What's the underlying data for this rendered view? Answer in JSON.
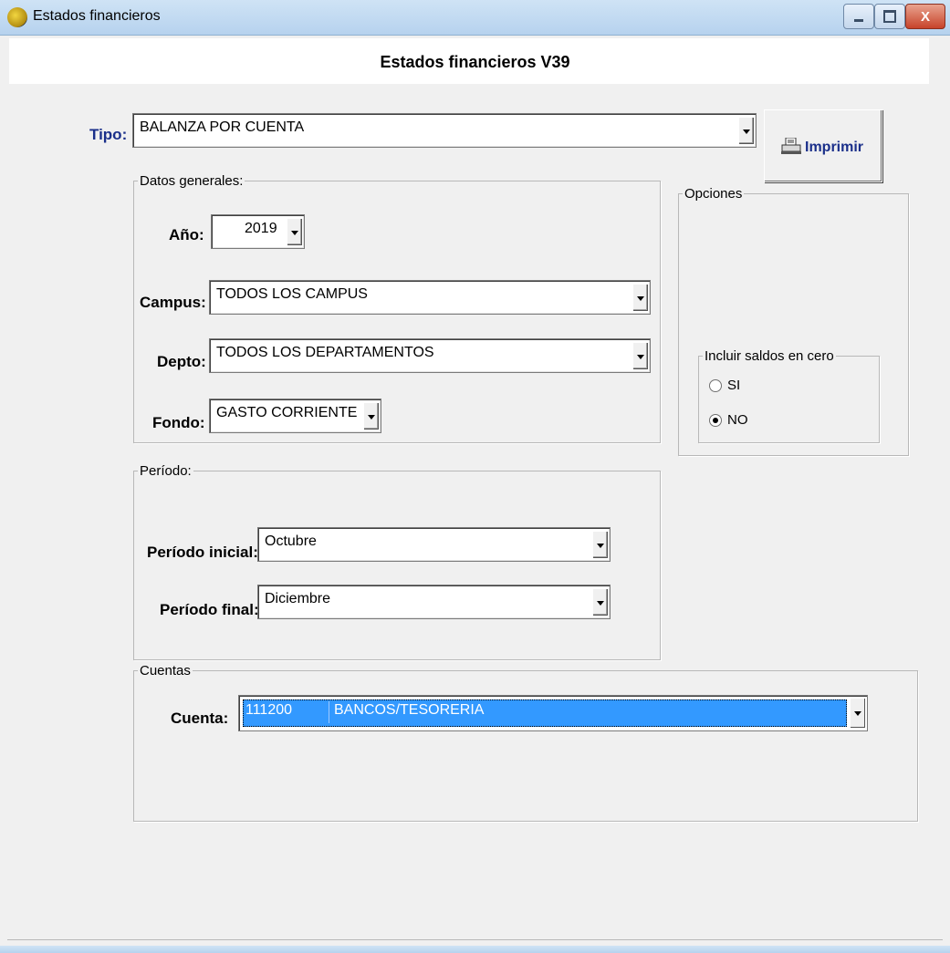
{
  "window": {
    "title": "Estados financieros",
    "buttons": {
      "minimize": "minimize",
      "maximize": "maximize",
      "close": "X"
    }
  },
  "form": {
    "title": "Estados financieros V39",
    "tipo": {
      "label": "Tipo:",
      "value": "BALANZA POR CUENTA"
    },
    "print_button": "Imprimir"
  },
  "datos_generales": {
    "legend": "Datos generales:",
    "anio": {
      "label": "Año:",
      "value": "2019"
    },
    "campus": {
      "label": "Campus:",
      "value": "TODOS LOS CAMPUS"
    },
    "depto": {
      "label": "Depto:",
      "value": "TODOS LOS DEPARTAMENTOS"
    },
    "fondo": {
      "label": "Fondo:",
      "value": "GASTO CORRIENTE"
    }
  },
  "opciones": {
    "legend": "Opciones",
    "saldos": {
      "legend": "Incluir saldos en cero",
      "options": [
        {
          "label": "SI",
          "checked": false
        },
        {
          "label": "NO",
          "checked": true
        }
      ]
    }
  },
  "periodo": {
    "legend": "Período:",
    "inicial": {
      "label": "Período inicial:",
      "value": "Octubre"
    },
    "final": {
      "label": "Período final:",
      "value": "Diciembre"
    }
  },
  "cuentas": {
    "legend": "Cuentas",
    "cuenta": {
      "label": "Cuenta:",
      "code": "111200",
      "description": "BANCOS/TESORERIA"
    }
  },
  "colors": {
    "label_blue": "#1a2f8a",
    "selection": "#3399ff",
    "titlebar": "#b6d2ee"
  }
}
